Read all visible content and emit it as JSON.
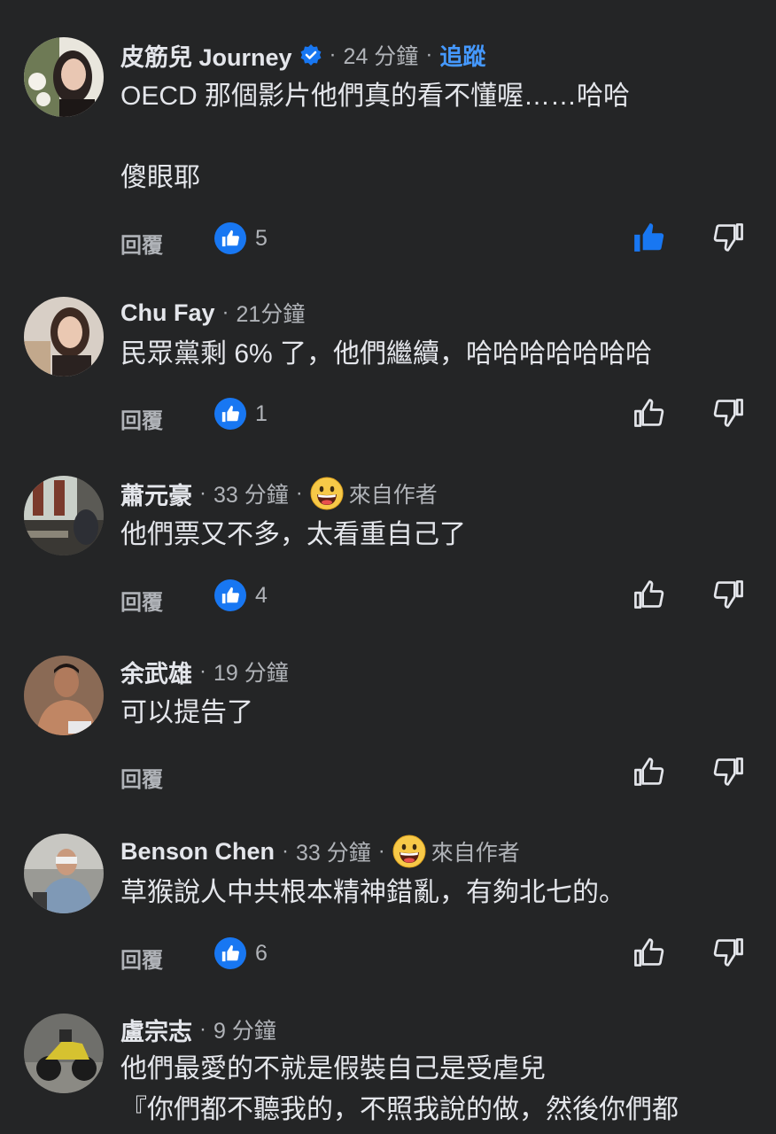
{
  "comments": [
    {
      "name": "皮筋兒 Journey",
      "verified": true,
      "time": "24 分鐘",
      "follow_label": "追蹤",
      "lines": [
        "OECD 那個影片他們真的看不懂喔……哈哈",
        "",
        "傻眼耶"
      ],
      "reply_label": "回覆",
      "likes": "5",
      "liked": true
    },
    {
      "name": "Chu Fay",
      "time": "21分鐘",
      "lines": [
        "民眾黨剩 6% 了，他們繼續，哈哈哈哈哈哈哈"
      ],
      "reply_label": "回覆",
      "likes": "1"
    },
    {
      "name": "蕭元豪",
      "time": "33 分鐘",
      "author_label": "來自作者",
      "lines": [
        "他們票又不多，太看重自己了"
      ],
      "reply_label": "回覆",
      "likes": "4"
    },
    {
      "name": "余武雄",
      "time": "19 分鐘",
      "lines": [
        "可以提告了"
      ],
      "reply_label": "回覆"
    },
    {
      "name": "Benson Chen",
      "time": "33 分鐘",
      "author_label": "來自作者",
      "lines": [
        "草猴說人中共根本精神錯亂，有夠北七的。"
      ],
      "reply_label": "回覆",
      "likes": "6"
    },
    {
      "name": "盧宗志",
      "time": "9 分鐘",
      "lines": [
        "他們最愛的不就是假裝自己是受虐兒",
        "『你們都不聽我的，不照我說的做，然後你們都"
      ]
    }
  ],
  "colors": {
    "background": "#242526",
    "primary_text": "#e4e6eb",
    "secondary_text": "#b0b3b8",
    "accent_blue": "#1877f2",
    "follow_blue": "#4599ff"
  },
  "icons": {
    "verified": "verified-badge-icon",
    "like_badge": "thumbs-up-icon",
    "like_button": "thumbs-up-outline-icon",
    "dislike_button": "thumbs-down-outline-icon",
    "author_emoji": "grinning-face-icon"
  }
}
